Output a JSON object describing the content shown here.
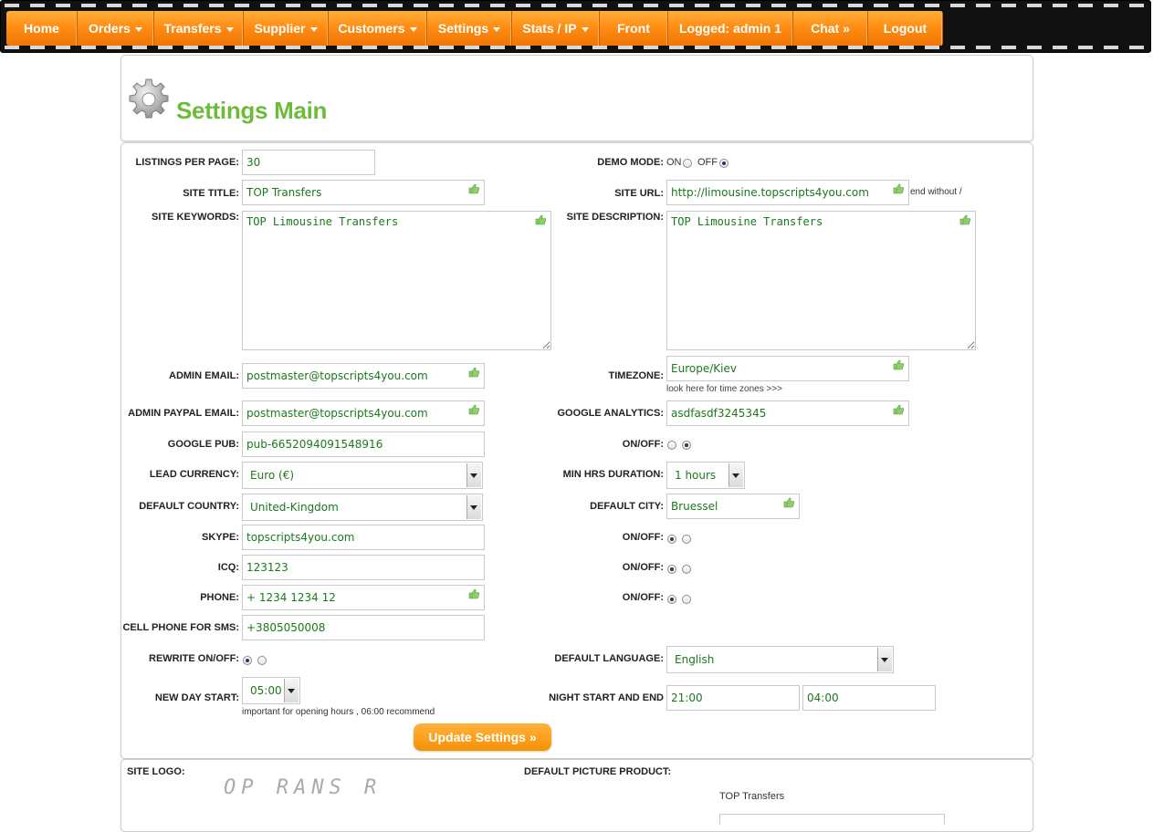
{
  "nav": {
    "items": [
      {
        "label": "Home",
        "caret": false
      },
      {
        "label": "Orders",
        "caret": true
      },
      {
        "label": "Transfers",
        "caret": true
      },
      {
        "label": "Supplier",
        "caret": true
      },
      {
        "label": "Customers",
        "caret": true
      },
      {
        "label": "Settings",
        "caret": true
      },
      {
        "label": "Stats / IP",
        "caret": true
      },
      {
        "label": "Front",
        "caret": false
      },
      {
        "label": "Logged: admin 1",
        "caret": false
      },
      {
        "label": "Chat »",
        "caret": false
      },
      {
        "label": "Logout",
        "caret": false
      }
    ]
  },
  "header": {
    "title": "Settings Main",
    "icon": "gear-icon"
  },
  "form": {
    "listings_per_page": {
      "label": "LISTINGS PER PAGE:",
      "value": "30"
    },
    "demo_mode": {
      "label": "DEMO MODE:",
      "on": "ON",
      "off": "OFF",
      "selected": "off"
    },
    "site_title": {
      "label": "SITE TITLE:",
      "value": "TOP Transfers"
    },
    "site_url": {
      "label": "SITE URL:",
      "value": "http://limousine.topscripts4you.com",
      "hint": "end without /"
    },
    "site_keywords": {
      "label": "SITE KEYWORDS:",
      "value": "TOP Limousine Transfers"
    },
    "site_description": {
      "label": "SITE DESCRIPTION:",
      "value": "TOP Limousine Transfers"
    },
    "admin_email": {
      "label": "ADMIN EMAIL:",
      "value": "postmaster@topscripts4you.com"
    },
    "timezone": {
      "label": "TIMEZONE:",
      "value": "Europe/Kiev",
      "hint": "look here for time zones >>>"
    },
    "admin_paypal_email": {
      "label": "ADMIN PAYPAL EMAIL:",
      "value": "postmaster@topscripts4you.com"
    },
    "google_analytics": {
      "label": "GOOGLE ANALYTICS:",
      "value": "asdfasdf3245345"
    },
    "google_pub": {
      "label": "GOOGLE PUB:",
      "value": "pub-6652094091548916"
    },
    "onoff_1": {
      "label": "ON/OFF:",
      "selected": "off"
    },
    "lead_currency": {
      "label": "LEAD CURRENCY:",
      "value": "Euro (€)"
    },
    "min_hrs_duration": {
      "label": "MIN HRS DURATION:",
      "value": "1 hours"
    },
    "default_country": {
      "label": "DEFAULT COUNTRY:",
      "value": "United-Kingdom"
    },
    "default_city": {
      "label": "DEFAULT CITY:",
      "value": "Bruessel"
    },
    "skype": {
      "label": "SKYPE:",
      "value": "topscripts4you.com"
    },
    "onoff_2": {
      "label": "ON/OFF:",
      "selected": "on"
    },
    "icq": {
      "label": "ICQ:",
      "value": "123123"
    },
    "onoff_3": {
      "label": "ON/OFF:",
      "selected": "on"
    },
    "phone": {
      "label": "PHONE:",
      "value": "+ 1234 1234 12"
    },
    "onoff_4": {
      "label": "ON/OFF:",
      "selected": "on"
    },
    "cell_phone_sms": {
      "label": "CELL PHONE FOR SMS:",
      "value": "+3805050008"
    },
    "rewrite": {
      "label": "REWRITE ON/OFF:",
      "selected": "on"
    },
    "default_language": {
      "label": "DEFAULT LANGUAGE:",
      "value": "English"
    },
    "new_day_start": {
      "label": "NEW DAY START:",
      "value": "05:00",
      "hint": "important for opening hours , 06:00 recommend"
    },
    "night_start_end": {
      "label": "NIGHT START AND END",
      "start": "21:00",
      "end": "04:00"
    },
    "submit_label": "Update Settings »"
  },
  "logo_section": {
    "site_logo_label": "SITE LOGO:",
    "site_logo_text": "OP RANS R",
    "default_picture_label": "DEFAULT PICTURE PRODUCT:",
    "product_caption": "TOP Transfers"
  },
  "colors": {
    "nav_orange": "#ff8c12",
    "title_green": "#6dbb3b",
    "value_green": "#1a7a1a",
    "button_orange": "#f79006"
  }
}
